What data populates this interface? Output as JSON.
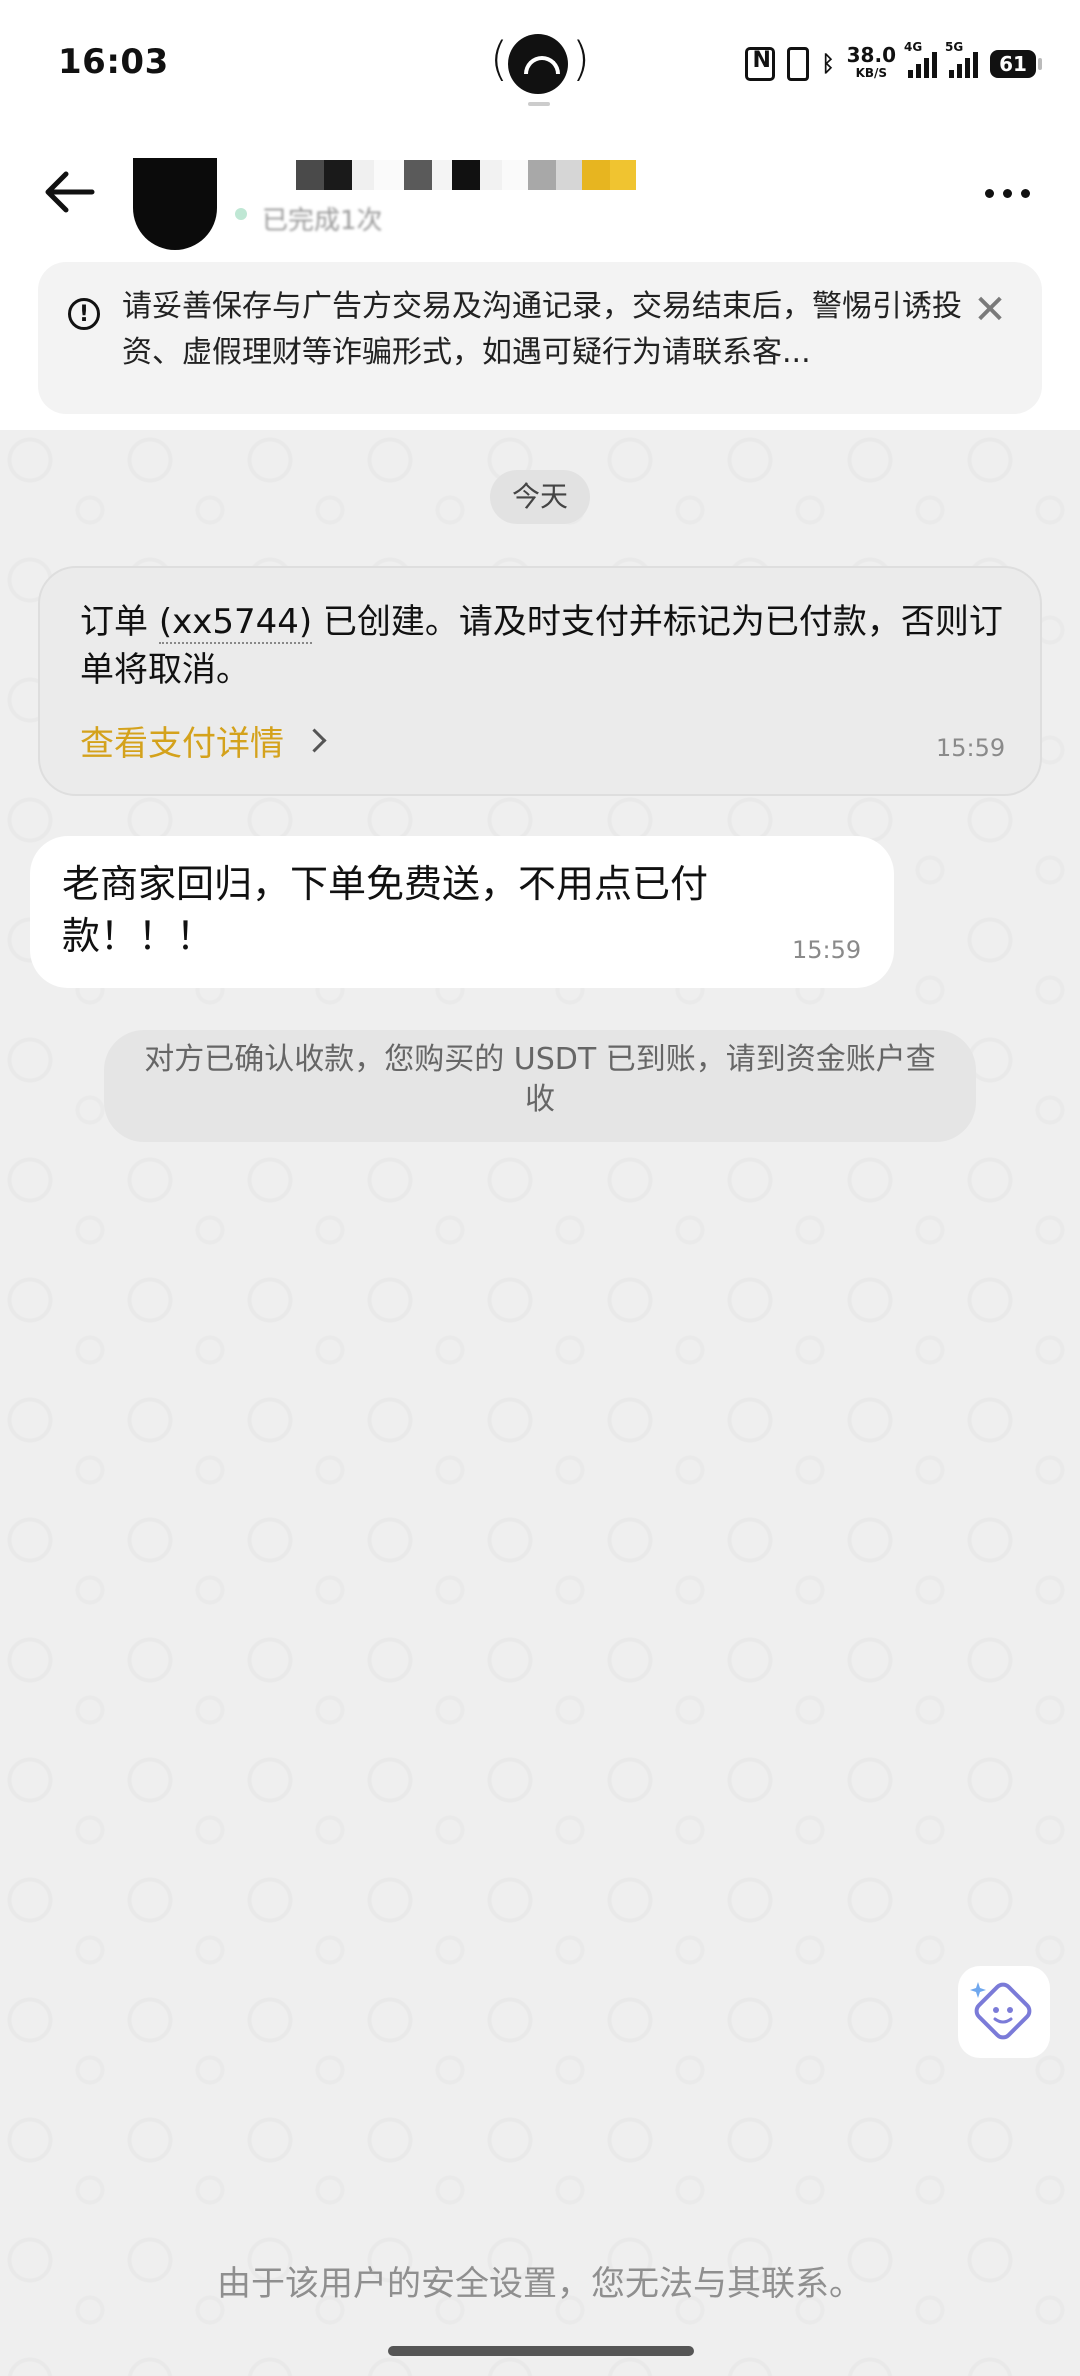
{
  "status_bar": {
    "time": "16:03",
    "network_speed": "38.0",
    "network_speed_unit": "KB/S",
    "signal1_tag": "4G",
    "signal2_tag": "5G",
    "battery": "61"
  },
  "header": {
    "subtitle": "已完成1次",
    "more_icon": "more-horizontal-icon",
    "back_icon": "arrow-left-icon"
  },
  "notice": {
    "icon": "!",
    "text": "请妥善保存与广告方交易及沟通记录，交易结束后，警惕引诱投资、虚假理财等诈骗形式，如遇可疑行为请联系客...",
    "close": "✕"
  },
  "chat": {
    "date_label": "今天",
    "order_card": {
      "prefix": "订单 ",
      "order_id": "(xx5744)",
      "suffix": " 已创建。请及时支付并标记为已付款，否则订单将取消。",
      "link_label": "查看支付详情",
      "time": "15:59"
    },
    "message": {
      "text": "老商家回归，下单免费送，不用点已付款！！！",
      "time": "15:59"
    },
    "system_message": "对方已确认收款，您购买的 USDT 已到账，请到资金账户查收"
  },
  "footer": {
    "disabled_notice": "由于该用户的安全设置，您无法与其联系。"
  },
  "colors": {
    "accent_gold": "#d4a21c",
    "assistant_purple": "#7b7bd8"
  }
}
